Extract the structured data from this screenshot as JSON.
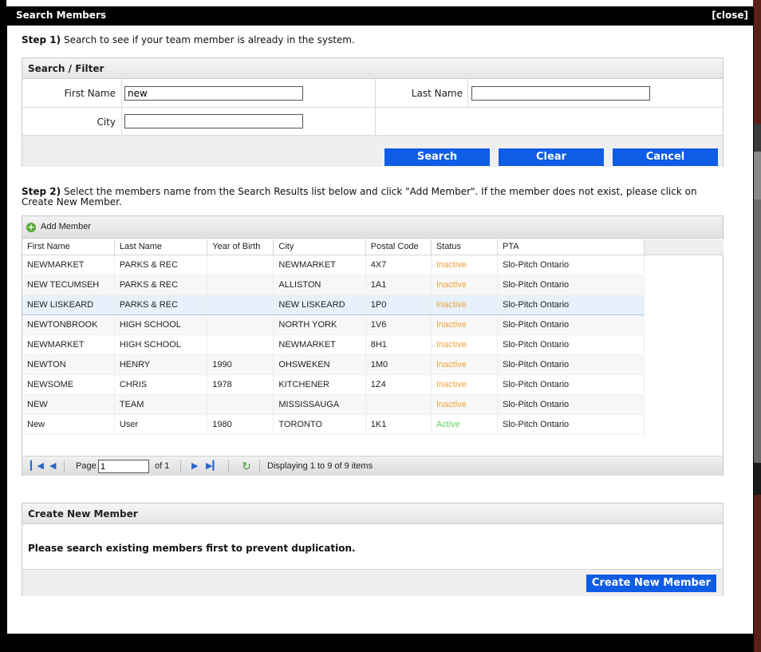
{
  "dialog": {
    "title": "Search Members",
    "close_label": "[close]"
  },
  "step1": {
    "prefix": "Step 1)",
    "text": "Search to see if your team member is already in the system."
  },
  "filter": {
    "header": "Search / Filter",
    "first_name_label": "First Name",
    "first_name_value": "new",
    "last_name_label": "Last Name",
    "last_name_value": "",
    "city_label": "City",
    "city_value": "",
    "search_button": "Search",
    "clear_button": "Clear",
    "cancel_button": "Cancel"
  },
  "step2": {
    "prefix": "Step 2)",
    "text": "Select the members name from the Search Results list below and click \"Add Member\". If the member does not exist, please click on Create New Member."
  },
  "grid": {
    "add_member_label": "Add Member",
    "columns": [
      "First Name",
      "Last Name",
      "Year of Birth",
      "City",
      "Postal Code",
      "Status",
      "PTA"
    ],
    "rows": [
      {
        "first": "NEWMARKET",
        "last": "PARKS & REC",
        "yob": "",
        "city": "NEWMARKET",
        "postal": "4X7",
        "status": "Inactive",
        "pta": "Slo-Pitch Ontario"
      },
      {
        "first": "NEW TECUMSEH",
        "last": "PARKS & REC",
        "yob": "",
        "city": "ALLISTON",
        "postal": "1A1",
        "status": "Inactive",
        "pta": "Slo-Pitch Ontario"
      },
      {
        "first": "NEW LISKEARD",
        "last": "PARKS & REC",
        "yob": "",
        "city": "NEW LISKEARD",
        "postal": "1P0",
        "status": "Inactive",
        "pta": "Slo-Pitch Ontario"
      },
      {
        "first": "NEWTONBROOK",
        "last": "HIGH SCHOOL",
        "yob": "",
        "city": "NORTH YORK",
        "postal": "1V6",
        "status": "Inactive",
        "pta": "Slo-Pitch Ontario"
      },
      {
        "first": "NEWMARKET",
        "last": "HIGH SCHOOL",
        "yob": "",
        "city": "NEWMARKET",
        "postal": "8H1",
        "status": "Inactive",
        "pta": "Slo-Pitch Ontario"
      },
      {
        "first": "NEWTON",
        "last": "HENRY",
        "yob": "1990",
        "city": "OHSWEKEN",
        "postal": "1M0",
        "status": "Inactive",
        "pta": "Slo-Pitch Ontario"
      },
      {
        "first": "NEWSOME",
        "last": "CHRIS",
        "yob": "1978",
        "city": "KITCHENER",
        "postal": "1Z4",
        "status": "Inactive",
        "pta": "Slo-Pitch Ontario"
      },
      {
        "first": "NEW",
        "last": "TEAM",
        "yob": "",
        "city": "MISSISSAUGA",
        "postal": "",
        "status": "Inactive",
        "pta": "Slo-Pitch Ontario"
      },
      {
        "first": "New",
        "last": "User",
        "yob": "1980",
        "city": "TORONTO",
        "postal": "1K1",
        "status": "Active",
        "pta": "Slo-Pitch Ontario"
      }
    ],
    "selected_row": 2,
    "pager": {
      "page_label": "Page",
      "page_value": "1",
      "of_label": "of 1",
      "displaying": "Displaying 1 to 9 of 9 items"
    }
  },
  "create": {
    "header": "Create New Member",
    "message": "Please search existing members first to prevent duplication.",
    "button": "Create New Member"
  },
  "colors": {
    "button_blue": "#0f5ce6",
    "inactive": "#f0a23a",
    "active": "#5fd35f"
  },
  "icons": [
    "plus-circle-icon",
    "first-page-icon",
    "prev-page-icon",
    "next-page-icon",
    "last-page-icon",
    "refresh-icon"
  ]
}
